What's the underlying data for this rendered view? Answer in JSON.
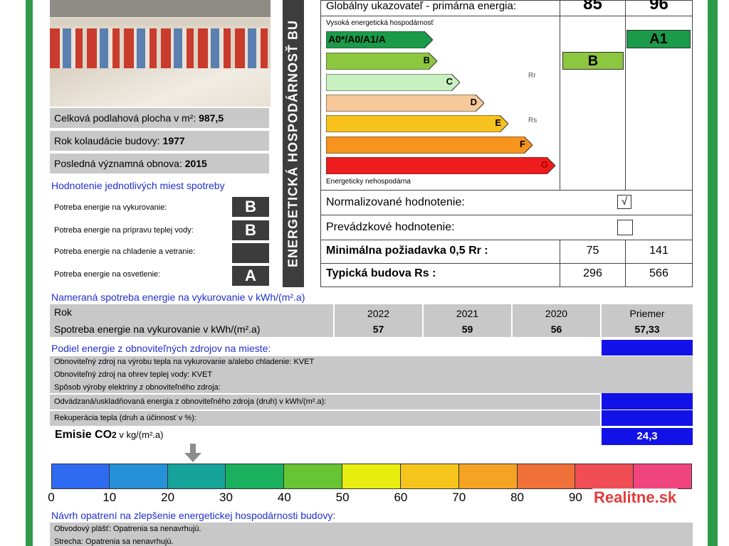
{
  "photo": {
    "caption": ""
  },
  "building_info": [
    {
      "label": "Celková podlahová plocha v m²: ",
      "value": "987,5"
    },
    {
      "label": "Rok kolaudácie budovy: ",
      "value": "1977"
    },
    {
      "label": "Posledná významná obnova: ",
      "value": "2015"
    }
  ],
  "consumption_points": {
    "heading": "Hodnotenie jednotlivých miest spotreby",
    "items": [
      {
        "label": "Potreba energie na vykurovanie:",
        "grade": "B"
      },
      {
        "label": "Potreba energie na prípravu teplej vody:",
        "grade": "B"
      },
      {
        "label": "Potreba energie na chladenie a vetranie:",
        "grade": ""
      },
      {
        "label": "Potreba energie na osvetlenie:",
        "grade": "A"
      }
    ]
  },
  "vertical_title": "ENERGETICKÁ HOSPODÁRNOSŤ BU",
  "scale": {
    "header_label": "Globálny ukazovateľ - primárna energia:",
    "col1_value": "85",
    "col2_value": "96",
    "top_note": "Vysoká energetická hospodárnosť",
    "bottom_note": "Energeticky nehospodárna",
    "classes": [
      "A0*/A0/A1/A",
      "B",
      "C",
      "D",
      "E",
      "F",
      "G"
    ],
    "class_colors": [
      "#1b9b4a",
      "#8dc63f",
      "#c9f0c0",
      "#f7c99a",
      "#f7c21d",
      "#f7941d",
      "#ee1c1c"
    ],
    "rr_marker": "Rr",
    "rs_marker": "Rs",
    "col1_class": "B",
    "col1_class_color": "#8dc63f",
    "col2_class": "A1",
    "col2_class_color": "#1b9b4a"
  },
  "ratings": {
    "normalized_label": "Normalizované hodnotenie:",
    "normalized_checked": "√",
    "operational_label": "Prevádzkové hodnotenie:",
    "min_req_label": "Minimálna požiadavka 0,5 Rr :",
    "min_req_values": [
      "75",
      "141"
    ],
    "typical_label": "Typická budova Rs :",
    "typical_values": [
      "296",
      "566"
    ]
  },
  "measured": {
    "heading": "Nameraná spotreba energie na vykurovanie v kWh/(m².a)",
    "row1_label": "Rok",
    "row2_label": "Spotreba energie na vykurovanie v kWh/(m².a)",
    "columns": [
      {
        "year": "2022",
        "value": "57"
      },
      {
        "year": "2021",
        "value": "59"
      },
      {
        "year": "2020",
        "value": "56"
      },
      {
        "year": "Priemer",
        "value": "57,33"
      }
    ]
  },
  "renewables": {
    "heading": "Podiel energie z obnoviteľných zdrojov na mieste:",
    "lines": [
      "Obnoviteľný zdroj na výrobu tepla na vykurovanie a/alebo chladenie: KVET",
      "Obnoviteľný zdroj na ohrev teplej vody: KVET",
      "Spôsob výroby elektriny z obnoviteľného zdroja:",
      "Odvádzaná/uskladňovaná energia z obnoviteľného zdroja (druh) v kWh/(m².a):",
      "Rekuperácia tepla (druh a účinnosť v %):"
    ]
  },
  "emissions": {
    "label": "Emisie CO",
    "sub": "2",
    "unit": " v kg/(m².a)",
    "value": "24,3",
    "value_numeric": 24.3
  },
  "co2_scale": {
    "ticks": [
      "0",
      "10",
      "20",
      "30",
      "40",
      "50",
      "60",
      "70",
      "80",
      "90"
    ],
    "colors": [
      "#2f6bf0",
      "#2690d8",
      "#16a39a",
      "#1ab05e",
      "#67c432",
      "#e8ee10",
      "#f6c51c",
      "#f5a323",
      "#f0703a",
      "#f04d55",
      "#f0447f"
    ]
  },
  "proposals": {
    "heading": "Návrh opatrení na zlepšenie energetickej hospodárnosti budovy:",
    "items": [
      {
        "label": "Obvodový plášť: ",
        "value": "Opatrenia sa nenavrhujú."
      },
      {
        "label": "Strecha: ",
        "value": "Opatrenia sa nenavrhujú."
      }
    ]
  },
  "watermark": "Realitne.sk"
}
